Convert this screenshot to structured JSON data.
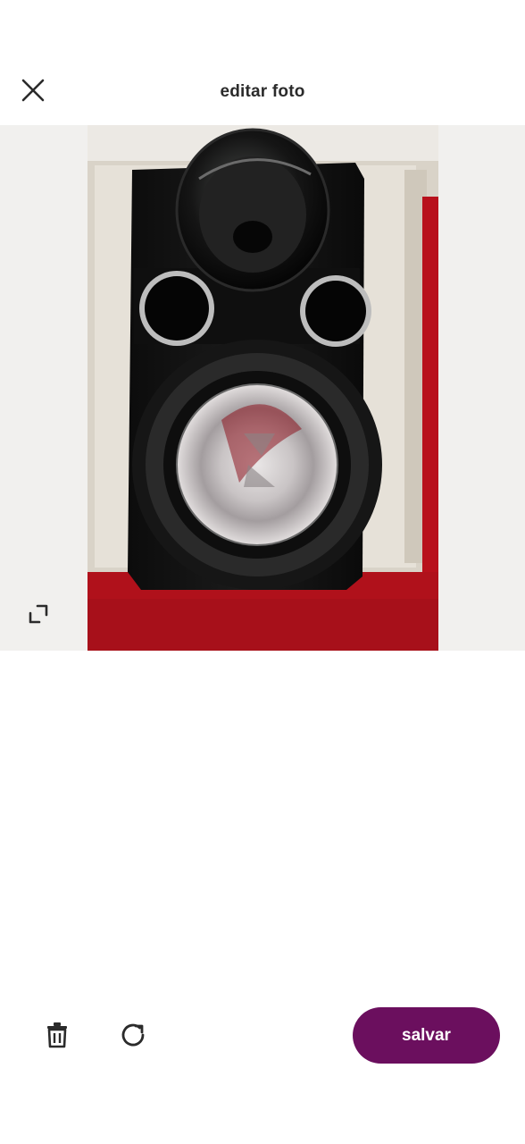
{
  "header": {
    "title": "editar foto",
    "close_icon": "close-icon"
  },
  "photo": {
    "subject": "speaker-photo",
    "expand_icon": "expand-icon"
  },
  "toolbar": {
    "delete_icon": "trash-icon",
    "rotate_icon": "rotate-icon",
    "save_label": "salvar"
  },
  "colors": {
    "accent": "#6b0f5e",
    "title_text": "#2b2b2b",
    "photo_bg": "#f1f0ee"
  }
}
